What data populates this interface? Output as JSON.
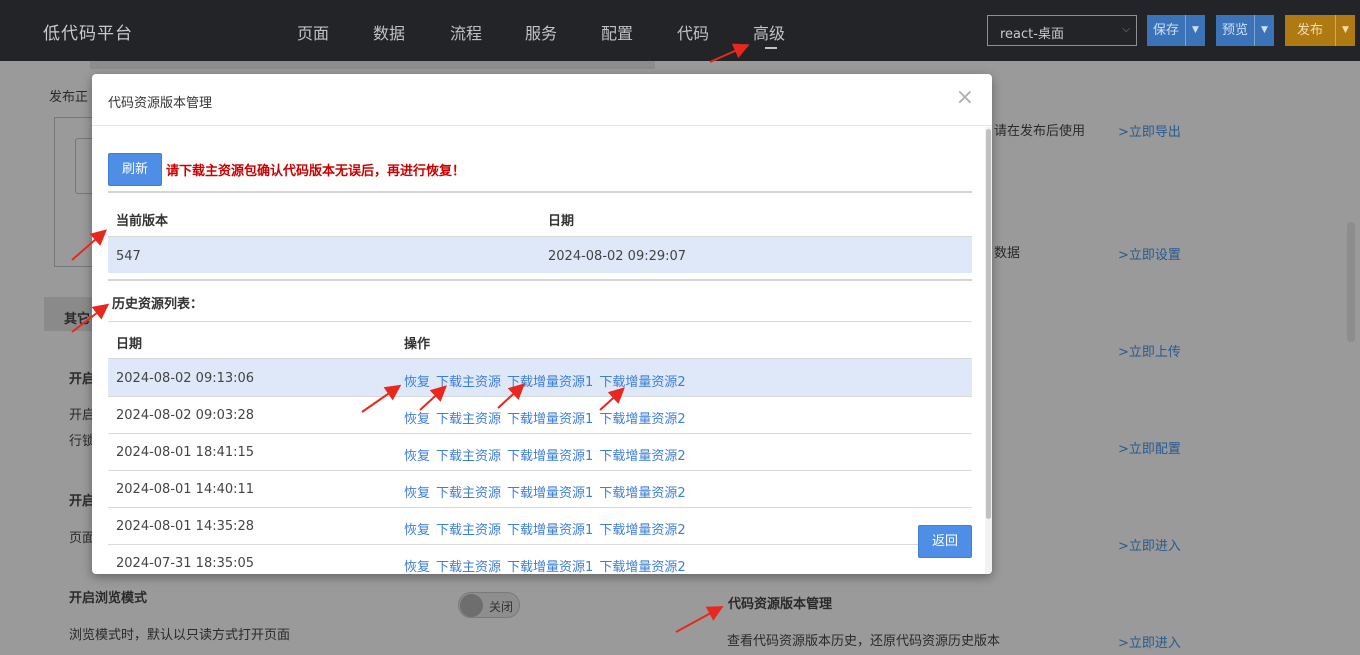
{
  "topbar": {
    "brand": "低代码平台",
    "nav": [
      "页面",
      "数据",
      "流程",
      "服务",
      "配置",
      "代码",
      "高级"
    ],
    "platform_select": "react-桌面",
    "save": "保存",
    "preview": "预览",
    "publish": "发布"
  },
  "background": {
    "publish_prefix": "发布正",
    "export_hint": "请在发布后使用",
    "export_link": ">立即导出",
    "data_hint": "数据",
    "settings_link": ">立即设置",
    "upload_link": ">立即上传",
    "config_link": ">立即配置",
    "enter_link": ">立即进入",
    "tab_other": "其它",
    "open1": "开启",
    "open1_desc1": "开启",
    "open1_desc2": "行锁",
    "open2": "开启",
    "page_desc": "页面",
    "browse_mode_title": "开启浏览模式",
    "browse_mode_desc": "浏览模式时，默认以只读方式打开页面",
    "toggle_label": "关闭",
    "version_mgmt_title": "代码资源版本管理",
    "version_mgmt_desc": "查看代码资源版本历史，还原代码资源历史版本",
    "version_mgmt_link": ">立即进入"
  },
  "modal": {
    "title": "代码资源版本管理",
    "close": "×",
    "refresh": "刷新",
    "warning": "请下载主资源包确认代码版本无误后，再进行恢复！",
    "current": {
      "headers": [
        "当前版本",
        "日期"
      ],
      "version": "547",
      "date": "2024-08-02 09:29:07"
    },
    "history_title": "历史资源列表：",
    "history_headers": [
      "日期",
      "操作"
    ],
    "actions": [
      "恢复",
      "下载主资源",
      "下载增量资源1",
      "下载增量资源2"
    ],
    "history": [
      "2024-08-02 09:13:06",
      "2024-08-02 09:03:28",
      "2024-08-01 18:41:15",
      "2024-08-01 14:40:11",
      "2024-08-01 14:35:28",
      "2024-07-31 18:35:05"
    ],
    "back": "返回"
  },
  "colors": {
    "topbar": "#222428",
    "primary": "#4f8ee6",
    "link": "#3d7ed6",
    "warning": "#cc0000",
    "highlight_row": "#dfe8f8",
    "annotation": "#e8281e"
  }
}
